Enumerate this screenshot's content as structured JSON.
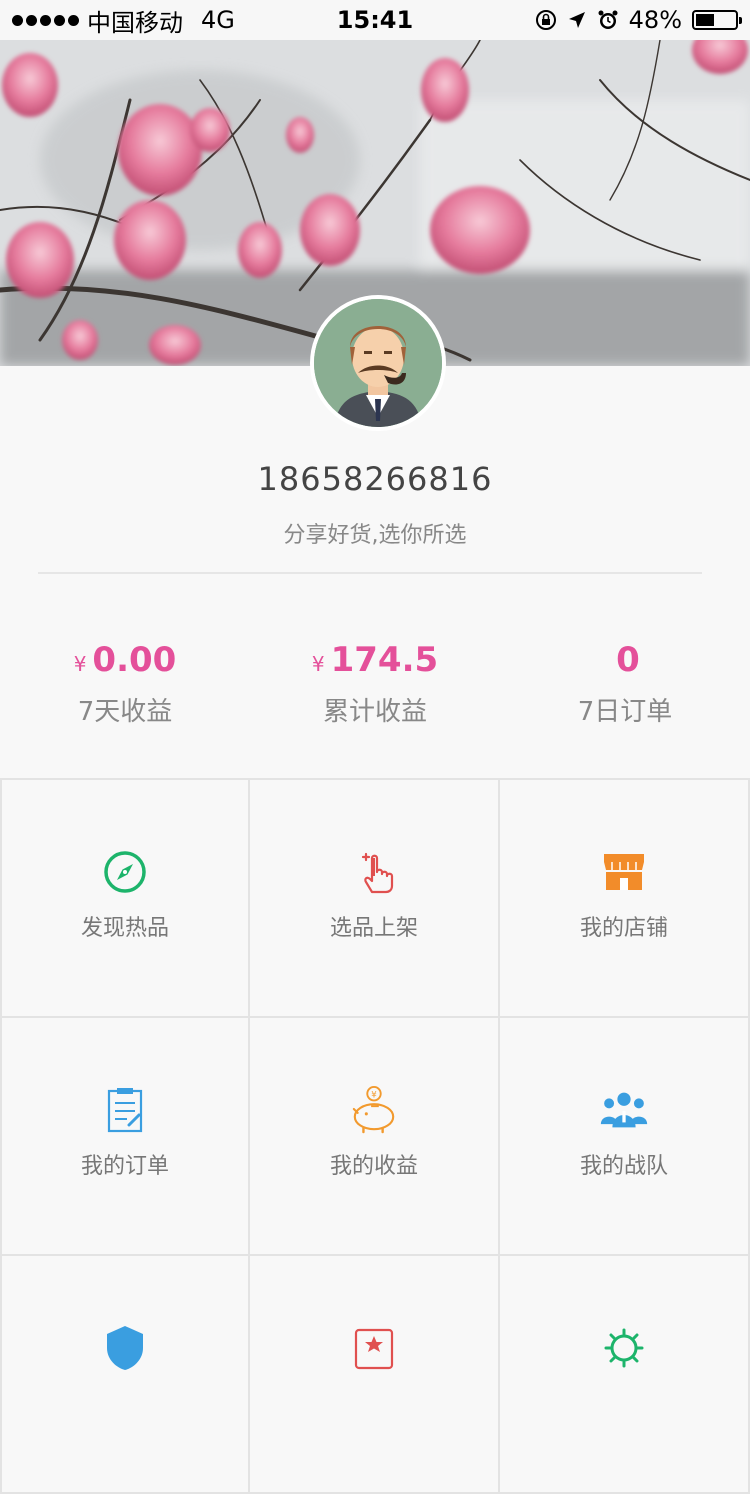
{
  "status_bar": {
    "carrier": "中国移动",
    "network": "4G",
    "time": "15:41",
    "battery": "48%",
    "battery_level": 0.48
  },
  "profile": {
    "phone": "18658266816",
    "slogan": "分享好货,选你所选"
  },
  "stats": [
    {
      "currency": "¥",
      "value": "0.00",
      "label": "7天收益"
    },
    {
      "currency": "¥",
      "value": "174.5",
      "label": "累计收益"
    },
    {
      "currency": "",
      "value": "0",
      "label": "7日订单"
    }
  ],
  "grid": [
    {
      "label": "发现热品",
      "icon": "compass-icon",
      "color": "#1db46b"
    },
    {
      "label": "选品上架",
      "icon": "tap-hand-icon",
      "color": "#e0504f"
    },
    {
      "label": "我的店铺",
      "icon": "store-icon",
      "color": "#f28c2a"
    },
    {
      "label": "我的订单",
      "icon": "clipboard-icon",
      "color": "#3a9ee0"
    },
    {
      "label": "我的收益",
      "icon": "piggy-bank-icon",
      "color": "#f29a2e"
    },
    {
      "label": "我的战队",
      "icon": "team-icon",
      "color": "#3a9ee0"
    },
    {
      "label": "",
      "icon": "shield-icon",
      "color": "#3a9ee0"
    },
    {
      "label": "",
      "icon": "badge-icon",
      "color": "#e0504f"
    },
    {
      "label": "",
      "icon": "settings-icon",
      "color": "#1db46b"
    }
  ],
  "colors": {
    "accent": "#e4509a"
  }
}
